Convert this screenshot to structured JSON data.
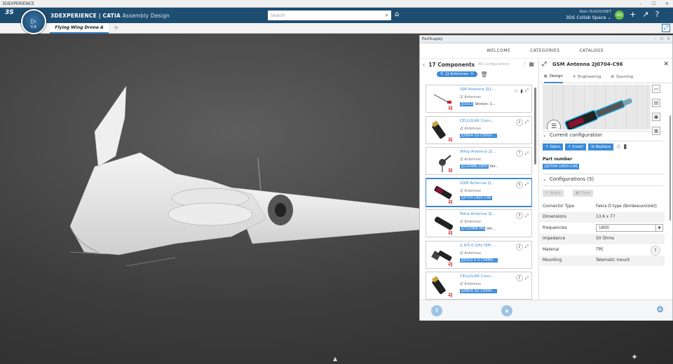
{
  "app": {
    "window_title": "3DEXPERIENCE",
    "brand_bold": "3DEXPERIENCE | CATIA",
    "brand_app": "Assembly Design",
    "compass_label": "V,R",
    "search_placeholder": "Search",
    "user_name": "Alain DUGOUSSET",
    "collab_space": "3DS Collab Space",
    "avatar_initials": "AD"
  },
  "tabs": [
    {
      "label": "Flying Wing Drone A"
    }
  ],
  "panel": {
    "title": "PartSupply",
    "nav": [
      "WELCOME",
      "CATEGORIES",
      "CATALOGS"
    ],
    "components_count": "17 Components",
    "configurations_count": "46 Configurations",
    "filter_chip": "2J Antennas",
    "components": [
      {
        "name": "ISM Antenna 2J1...",
        "manufacturer": "2J Antennas",
        "pn": "2J1013",
        "version": "Version: 1...",
        "badge": "",
        "selected": false
      },
      {
        "name": "CELLULAR Conn...",
        "manufacturer": "2J Antennas",
        "pn": "2J0B04-3G-C8950-...",
        "version": "",
        "badge": "2",
        "selected": false
      },
      {
        "name": "Whip Antenna 2J...",
        "manufacturer": "2J Antennas",
        "pn": "2J1204Bb-1800",
        "version": "Ver...",
        "badge": "7",
        "selected": false
      },
      {
        "name": "GSM Antenna 2J...",
        "manufacturer": "2J Antennas",
        "pn": "2J0704-1800-C96",
        "version": "",
        "badge": "5",
        "selected": true
      },
      {
        "name": "Tetra Antenna 2J...",
        "manufacturer": "2J Antennas",
        "pn": "2J7104M6-MS",
        "version": "Ver...",
        "badge": "3",
        "selected": false
      },
      {
        "name": "2.4/5.0 GHz ISM ...",
        "manufacturer": "2J Antennas",
        "pn": "2J0102-5.0-C968N-...",
        "version": "",
        "badge": "2",
        "selected": false
      },
      {
        "name": "CELLULAR Conn...",
        "manufacturer": "2J Antennas",
        "pn": "2J0B04-3G-C8940-...",
        "version": "",
        "badge": "2",
        "selected": false
      }
    ],
    "detail": {
      "title": "GSM Antenna 2J0704-C96",
      "tabs": [
        "Design",
        "Engineering",
        "Sourcing"
      ],
      "current_config_label": "Current configuration",
      "open_label": "Open",
      "insert_label": "Insert",
      "replace_label": "Replace",
      "part_number_label": "Part number",
      "part_number": "2J0704-1800-C96",
      "configurations_label": "Configurations (5)",
      "apply_label": "Apply",
      "clear_label": "Clear",
      "attributes": [
        {
          "key": "Connector Type",
          "value": "Fakra D type (Bordeauxviolet)"
        },
        {
          "key": "Dimensions",
          "value": "13.6 x 77"
        },
        {
          "key": "Frequencies",
          "value": "1800"
        },
        {
          "key": "Impedance",
          "value": "50 Ohms"
        },
        {
          "key": "Material",
          "value": "TPE"
        },
        {
          "key": "Mounting",
          "value": "Telematic mount"
        }
      ]
    }
  },
  "colors": {
    "topbar": "#1e4d72",
    "accent": "#3c8ad8",
    "viewport": "#3c3c3c"
  }
}
